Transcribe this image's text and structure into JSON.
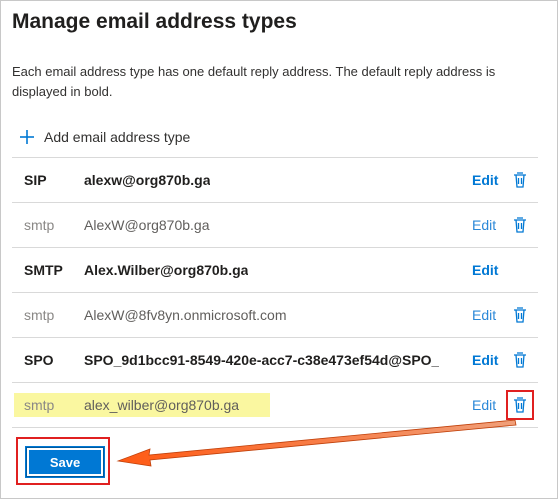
{
  "title": "Manage email address types",
  "description": "Each email address type has one default reply address. The default reply address is displayed in bold.",
  "add_label": "Add email address type",
  "edit_label": "Edit",
  "rows": [
    {
      "type": "SIP",
      "address": "alexw@org870b.ga",
      "default": true
    },
    {
      "type": "smtp",
      "address": "AlexW@org870b.ga",
      "default": false
    },
    {
      "type": "SMTP",
      "address": "Alex.Wilber@org870b.ga",
      "default": true
    },
    {
      "type": "smtp",
      "address": "AlexW@8fv8yn.onmicrosoft.com",
      "default": false
    },
    {
      "type": "SPO",
      "address": "SPO_9d1bcc91-8549-420e-acc7-c38e473ef54d@SPO_",
      "default": true
    },
    {
      "type": "smtp",
      "address": "alex_wilber@org870b.ga",
      "default": false
    }
  ],
  "save_label": "Save",
  "colors": {
    "accent": "#0078d4",
    "annotation": "#e02020",
    "highlight": "#faf7a0"
  }
}
